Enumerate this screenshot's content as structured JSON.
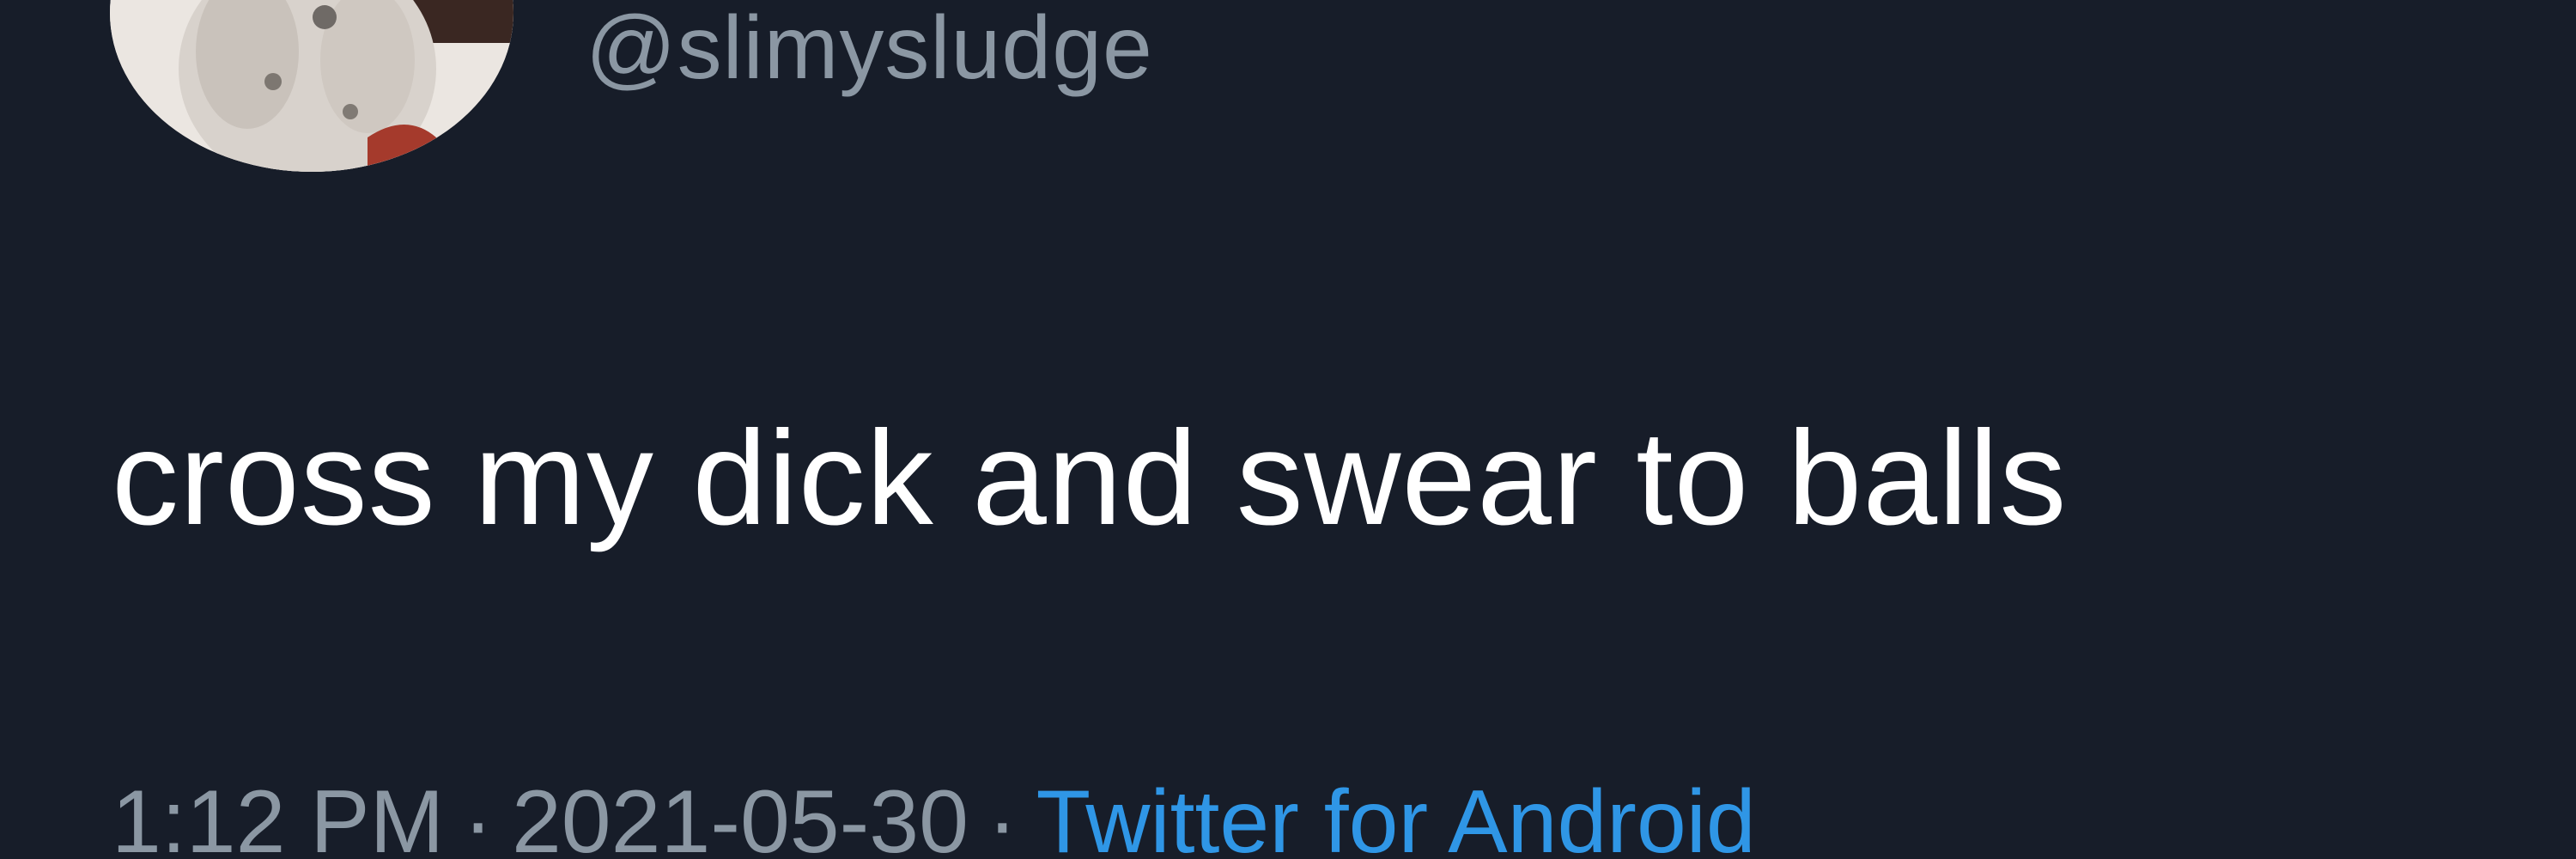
{
  "tweet": {
    "handle": "@slimysludge",
    "text": "cross my dick and swear to balls",
    "time": "1:12 PM",
    "separator": "·",
    "date": "2021-05-30",
    "source": "Twitter for Android",
    "avatar_icon": "profile-photo-icon"
  },
  "colors": {
    "background": "#171d29",
    "text": "#ffffff",
    "secondary_text": "#8b97a3",
    "link": "#2f96e6"
  }
}
